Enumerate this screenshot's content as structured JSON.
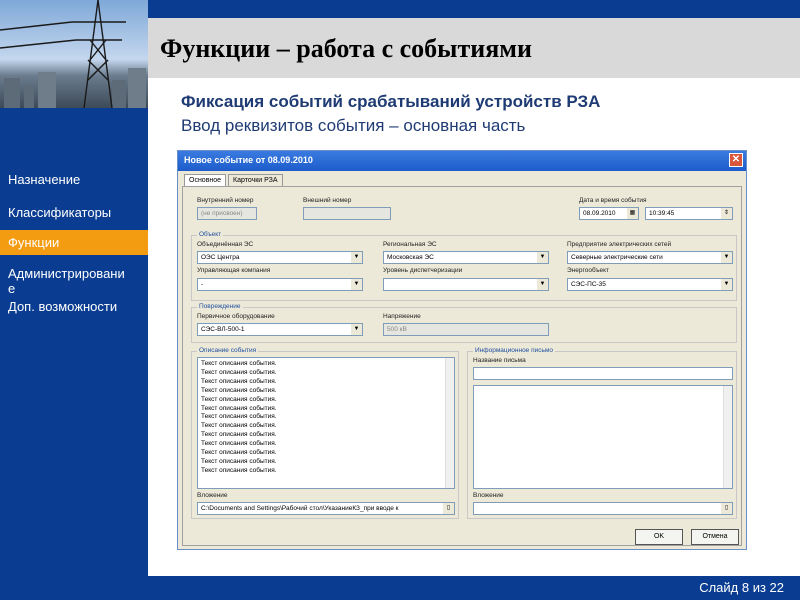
{
  "slide": {
    "title": "Функции – работа с событиями",
    "subtitle1": "Фиксация событий срабатываний устройств РЗА",
    "subtitle2": "Ввод реквизитов события – основная часть",
    "slide_counter": "Слайд 8 из 22"
  },
  "nav": {
    "items": [
      {
        "label": "Назначение"
      },
      {
        "label": "Классификаторы"
      },
      {
        "label": "Функции"
      },
      {
        "label": "Администрировани\nе"
      },
      {
        "label": "Доп. возможности"
      }
    ],
    "active_index": 2
  },
  "dialog": {
    "title": "Новое событие от 08.09.2010",
    "close": "✕",
    "tabs": [
      "Основное",
      "Карточки РЗА"
    ],
    "fields": {
      "internal_number_label": "Внутренний номер",
      "internal_number_value": "(не присвоен)",
      "external_number_label": "Внешний номер",
      "external_number_value": "",
      "datetime_label": "Дата и время события",
      "date_value": "08.09.2010",
      "time_value": "10:39:45"
    },
    "object": {
      "group_label": "Объект",
      "oes_label": "Объединённая ЭС",
      "oes_value": "ОЭС Центра",
      "res_label": "Региональная ЭС",
      "res_value": "Московская ЭС",
      "pes_label": "Предприятие электрических сетей",
      "pes_value": "Северные электрические сети",
      "company_label": "Управляющая компания",
      "company_value": "-",
      "dispatch_label": "Уровень диспетчеризации",
      "dispatch_value": "",
      "energy_obj_label": "Энергообъект",
      "energy_obj_value": "СЭС-ПС-35"
    },
    "damage": {
      "group_label": "Повреждение",
      "equipment_label": "Первичное оборудование",
      "equipment_value": "СЭС-ВЛ-500-1",
      "voltage_label": "Напряжение",
      "voltage_value": "500 кВ"
    },
    "description": {
      "group_label": "Описание события",
      "lines": [
        "Текст описания события.",
        "Текст описания события.",
        "Текст описания события.",
        "Текст описания события.",
        "Текст описания события.",
        "Текст описания события.",
        "Текст описания события.",
        "Текст описания события.",
        "Текст описания события.",
        "Текст описания события.",
        "Текст описания события.",
        "Текст описания события.",
        "Текст описания события."
      ],
      "attachment_label": "Вложение",
      "attachment_value": "C:\\Documents and Settings\\Рабочий стол\\УказаниеКЗ_при вводе к"
    },
    "letter": {
      "group_label": "Информационное письмо",
      "name_label": "Название письма",
      "name_value": "",
      "attachment_label": "Вложение",
      "attachment_value": ""
    },
    "buttons": {
      "ok": "OK",
      "cancel": "Отмена"
    }
  },
  "colors": {
    "brand_blue": "#0a3d91",
    "accent_orange": "#f39c12",
    "title_gray": "#d9d9d9"
  }
}
